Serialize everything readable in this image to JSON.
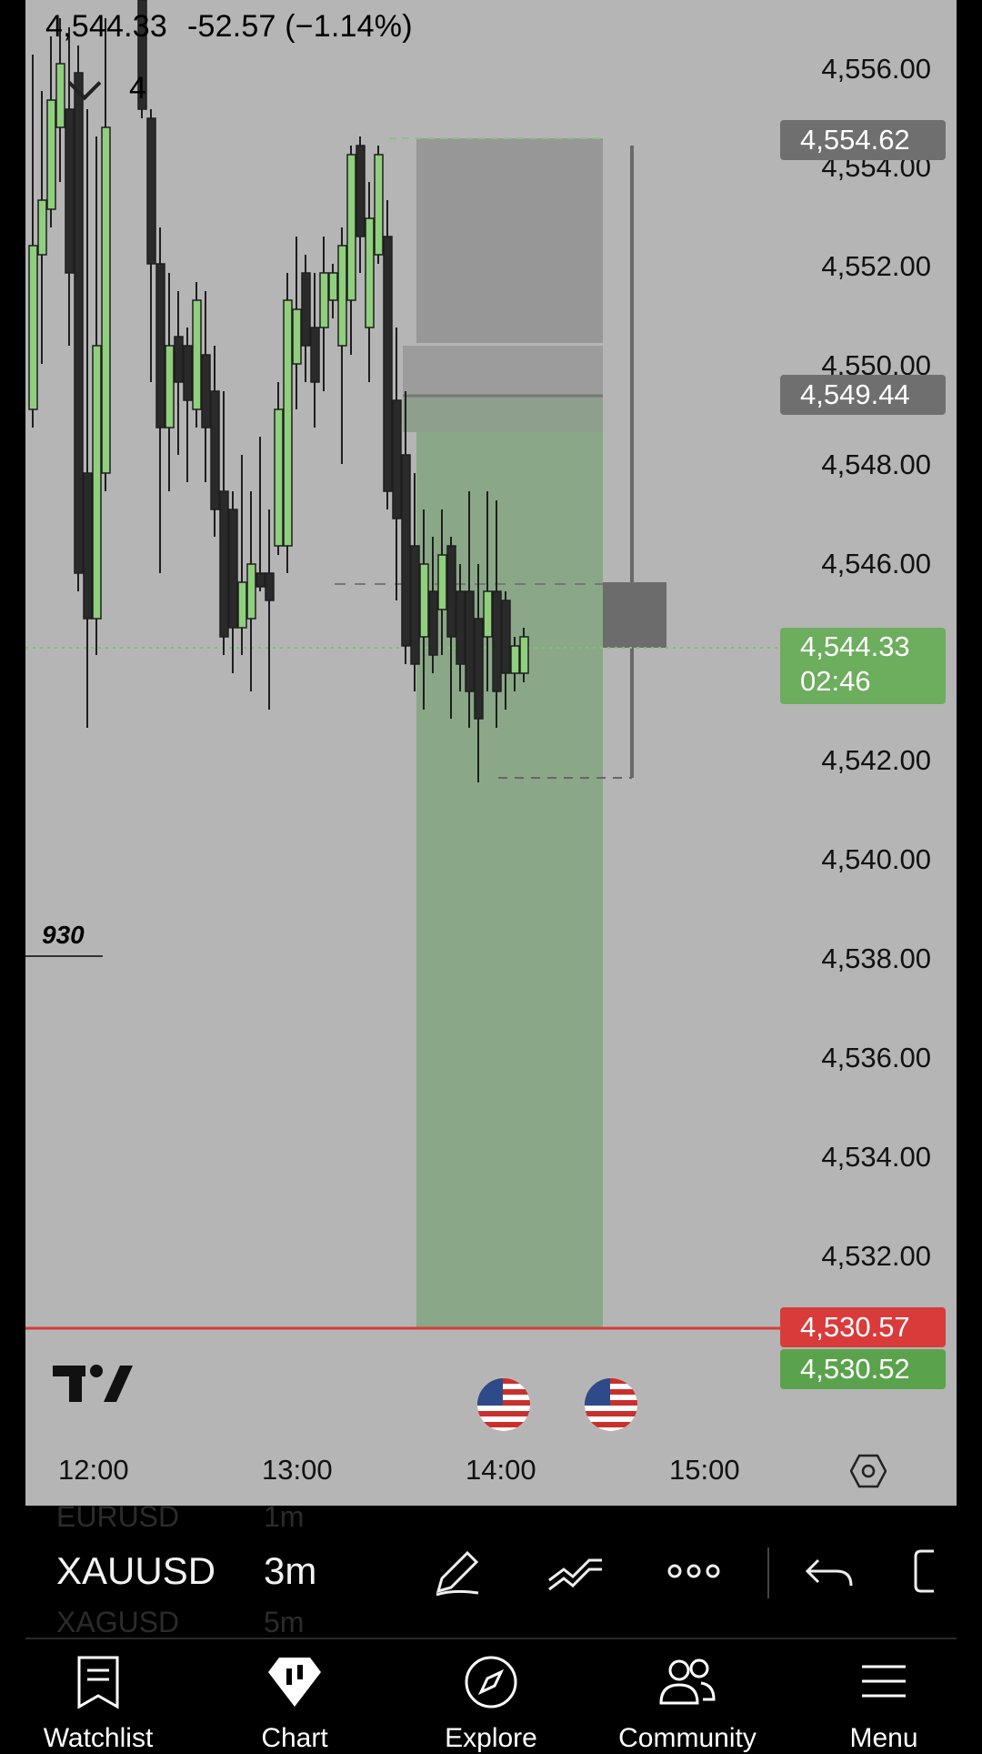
{
  "header": {
    "last_price": "4,544.33",
    "change": "-52.57 (−1.14%)",
    "indicator_count": "4"
  },
  "left_label": "930",
  "price_axis": {
    "ticks": [
      "4,556.00",
      "4,554.00",
      "4,552.00",
      "4,550.00",
      "4,548.00",
      "4,546.00",
      "4,542.00",
      "4,540.00",
      "4,538.00",
      "4,536.00",
      "4,534.00",
      "4,532.00"
    ],
    "tags": {
      "target_price": "4,554.62",
      "entry_price": "4,549.44",
      "current_price": "4,544.33",
      "countdown": "02:46",
      "red_level": "4,530.57",
      "green_level": "4,530.52"
    }
  },
  "time_axis": [
    "12:00",
    "13:00",
    "14:00",
    "15:00"
  ],
  "symbol_bar": {
    "symbol": "XAUUSD",
    "interval": "3m",
    "prev_symbol": "EURUSD",
    "prev_interval": "1m",
    "next_symbol": "XAGUSD",
    "next_interval": "5m"
  },
  "nav": {
    "watchlist": "Watchlist",
    "chart": "Chart",
    "explore": "Explore",
    "community": "Community",
    "menu": "Menu"
  },
  "colors": {
    "up_candle": "#8fcf7d",
    "down_candle": "#2a2a2a",
    "chart_bg": "#b5b5b5",
    "profit_zone": "#8aa887",
    "loss_zone": "#979797",
    "red_line": "#d93b3b",
    "green_tag": "#6cad5e",
    "grey_tag": "#6f6f6f"
  },
  "icons": [
    "chevron-down-icon",
    "settings-hexagon-icon",
    "tradingview-logo",
    "us-flag-icon",
    "pencil-icon",
    "drawing-tools-icon",
    "more-icon",
    "undo-icon",
    "fullscreen-icon",
    "watchlist-icon",
    "chart-icon",
    "explore-icon",
    "community-icon",
    "menu-icon"
  ]
}
